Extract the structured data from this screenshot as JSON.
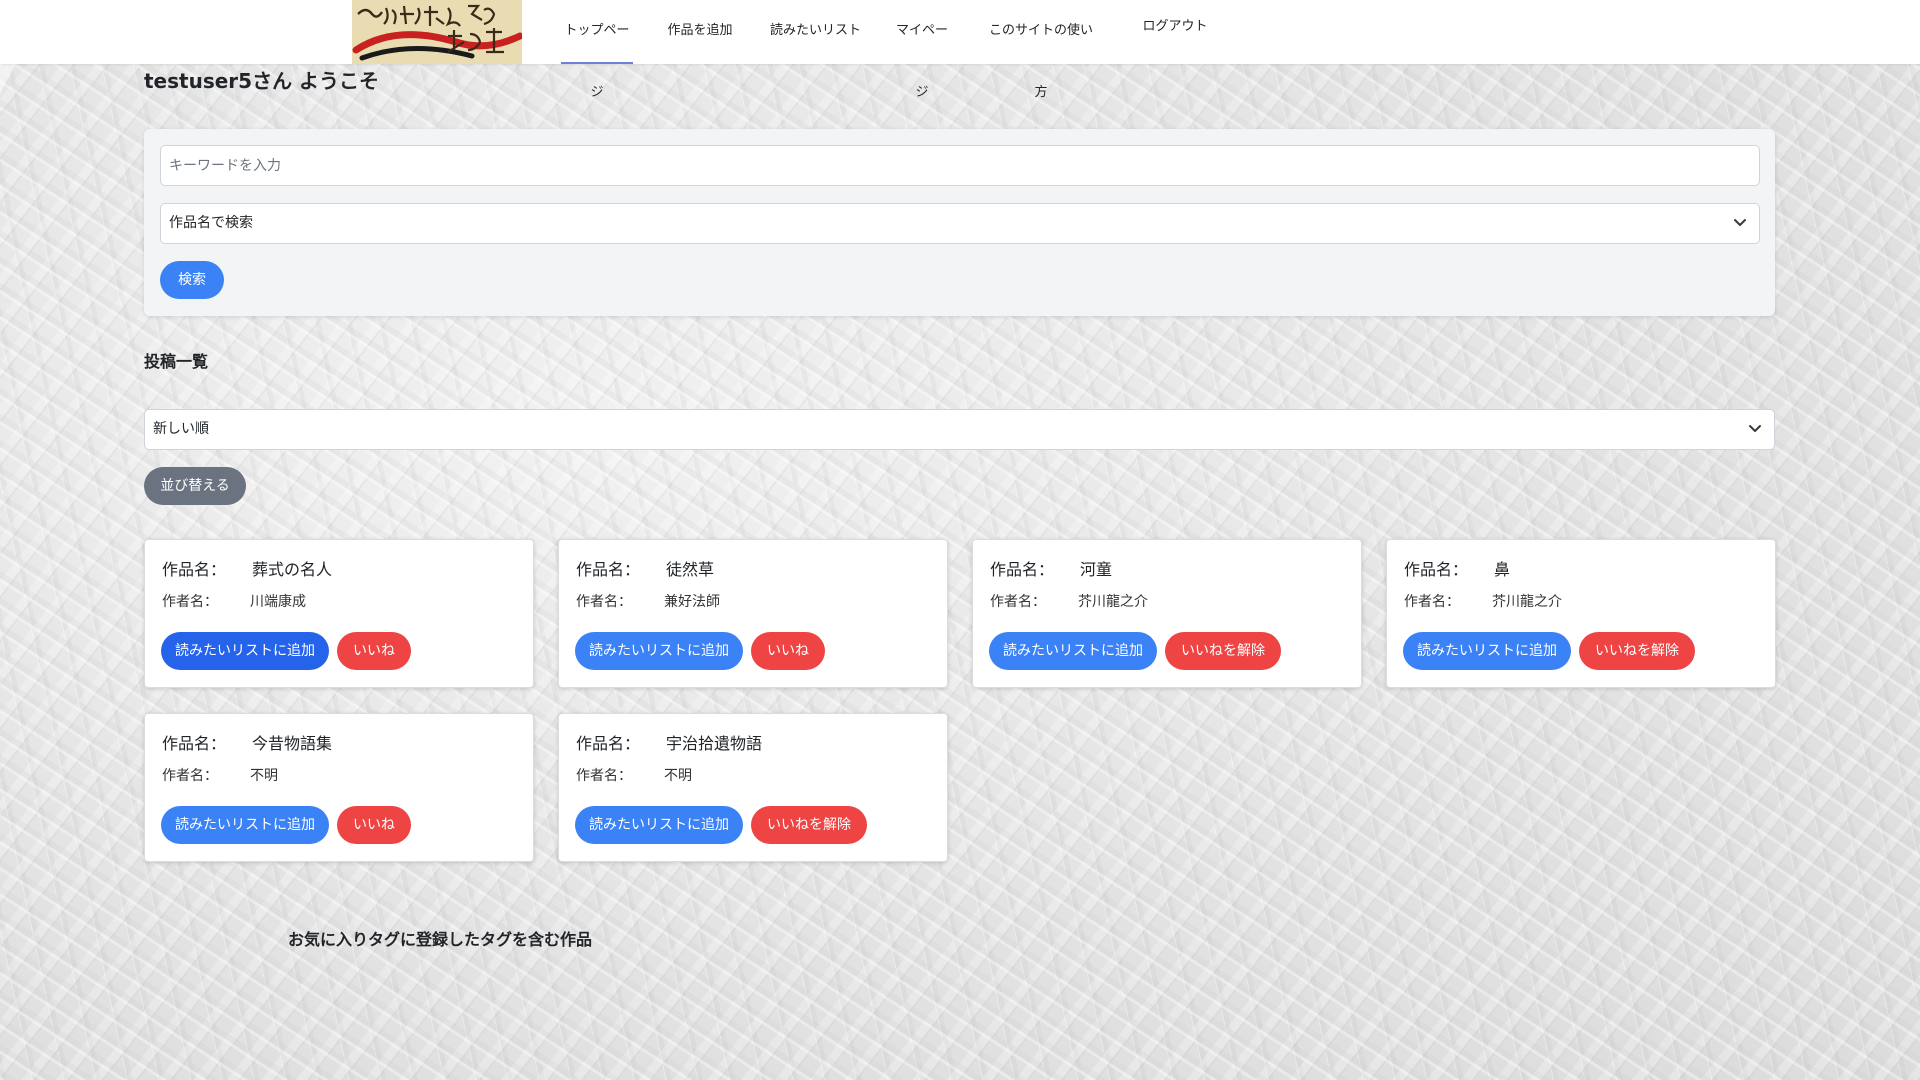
{
  "nav": {
    "items": [
      "トップページ",
      "作品を追加",
      "読みたいリスト",
      "マイページ",
      "このサイトの使い方"
    ],
    "logout": "ログアウト",
    "active_index": 0
  },
  "greeting": "testuser5さん ようこそ",
  "search": {
    "placeholder": "キーワードを入力",
    "type_selected": "作品名で検索",
    "button": "検索"
  },
  "posts": {
    "title": "投稿一覧",
    "sort_selected": "新しい順",
    "sort_button": "並び替える"
  },
  "labels": {
    "work": "作品名：",
    "author": "作者名："
  },
  "cards": [
    {
      "title": "葬式の名人",
      "author": "川端康成",
      "add_label": "読みたいリストに追加",
      "like_label": "いいね"
    },
    {
      "title": "徒然草",
      "author": "兼好法師",
      "add_label": "読みたいリストに追加",
      "like_label": "いいね"
    },
    {
      "title": "河童",
      "author": "芥川龍之介",
      "add_label": "読みたいリストに追加",
      "like_label": "いいねを解除"
    },
    {
      "title": "鼻",
      "author": "芥川龍之介",
      "add_label": "読みたいリストに追加",
      "like_label": "いいねを解除"
    },
    {
      "title": "今昔物語集",
      "author": "不明",
      "add_label": "読みたいリストに追加",
      "like_label": "いいね"
    },
    {
      "title": "宇治拾遺物語",
      "author": "不明",
      "add_label": "読みたいリストに追加",
      "like_label": "いいねを解除"
    }
  ],
  "favorites": {
    "title": "お気に入りタグに登録したタグを含む作品"
  },
  "colors": {
    "primary": "#3b82f6",
    "primary_dark": "#2563eb",
    "danger": "#ef4444",
    "secondary": "#6b7280",
    "active_underline": "#6f7fd6"
  },
  "icons": {
    "select_arrow": "chevron-down-icon"
  }
}
